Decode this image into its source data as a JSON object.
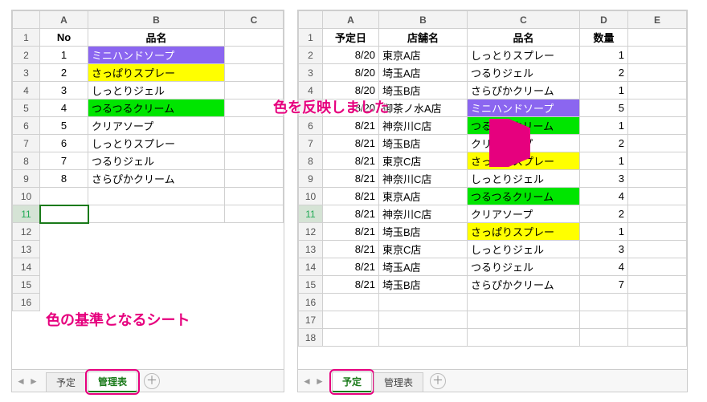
{
  "left": {
    "cols": [
      "A",
      "B",
      "C"
    ],
    "headers": {
      "A": "No",
      "B": "品名"
    },
    "rows": [
      {
        "n": "1",
        "name": "ミニハンドソープ",
        "fill": "purple"
      },
      {
        "n": "2",
        "name": "さっぱりスプレー",
        "fill": "yellow"
      },
      {
        "n": "3",
        "name": "しっとりジェル",
        "fill": ""
      },
      {
        "n": "4",
        "name": "つるつるクリーム",
        "fill": "green"
      },
      {
        "n": "5",
        "name": "クリアソープ",
        "fill": ""
      },
      {
        "n": "6",
        "name": "しっとりスプレー",
        "fill": ""
      },
      {
        "n": "7",
        "name": "つるりジェル",
        "fill": ""
      },
      {
        "n": "8",
        "name": "さらぴかクリーム",
        "fill": ""
      }
    ],
    "caption": "色の基準となるシート",
    "tabs": {
      "yotei": "予定",
      "kanri": "管理表"
    },
    "active_tab": "kanri"
  },
  "right": {
    "cols": [
      "A",
      "B",
      "C",
      "D",
      "E"
    ],
    "headers": {
      "A": "予定日",
      "B": "店舗名",
      "C": "品名",
      "D": "数量"
    },
    "rows": [
      {
        "d": "8/20",
        "s": "東京A店",
        "p": "しっとりスプレー",
        "q": "1",
        "fill": ""
      },
      {
        "d": "8/20",
        "s": "埼玉A店",
        "p": "つるりジェル",
        "q": "2",
        "fill": ""
      },
      {
        "d": "8/20",
        "s": "埼玉B店",
        "p": "さらぴかクリーム",
        "q": "1",
        "fill": ""
      },
      {
        "d": "8/20",
        "s": "御茶ノ水A店",
        "p": "ミニハンドソープ",
        "q": "5",
        "fill": "purple"
      },
      {
        "d": "8/21",
        "s": "神奈川C店",
        "p": "つるつるクリーム",
        "q": "1",
        "fill": "green"
      },
      {
        "d": "8/21",
        "s": "埼玉B店",
        "p": "クリアソープ",
        "q": "2",
        "fill": ""
      },
      {
        "d": "8/21",
        "s": "東京C店",
        "p": "さっぱりスプレー",
        "q": "1",
        "fill": "yellow"
      },
      {
        "d": "8/21",
        "s": "神奈川C店",
        "p": "しっとりジェル",
        "q": "3",
        "fill": ""
      },
      {
        "d": "8/21",
        "s": "東京A店",
        "p": "つるつるクリーム",
        "q": "4",
        "fill": "green"
      },
      {
        "d": "8/21",
        "s": "神奈川C店",
        "p": "クリアソープ",
        "q": "2",
        "fill": ""
      },
      {
        "d": "8/21",
        "s": "埼玉B店",
        "p": "さっぱりスプレー",
        "q": "1",
        "fill": "yellow"
      },
      {
        "d": "8/21",
        "s": "東京C店",
        "p": "しっとりジェル",
        "q": "3",
        "fill": ""
      },
      {
        "d": "8/21",
        "s": "埼玉A店",
        "p": "つるりジェル",
        "q": "4",
        "fill": ""
      },
      {
        "d": "8/21",
        "s": "埼玉B店",
        "p": "さらぴかクリーム",
        "q": "7",
        "fill": ""
      }
    ],
    "caption": "色を反映しました",
    "tabs": {
      "yotei": "予定",
      "kanri": "管理表"
    },
    "active_tab": "yotei"
  }
}
